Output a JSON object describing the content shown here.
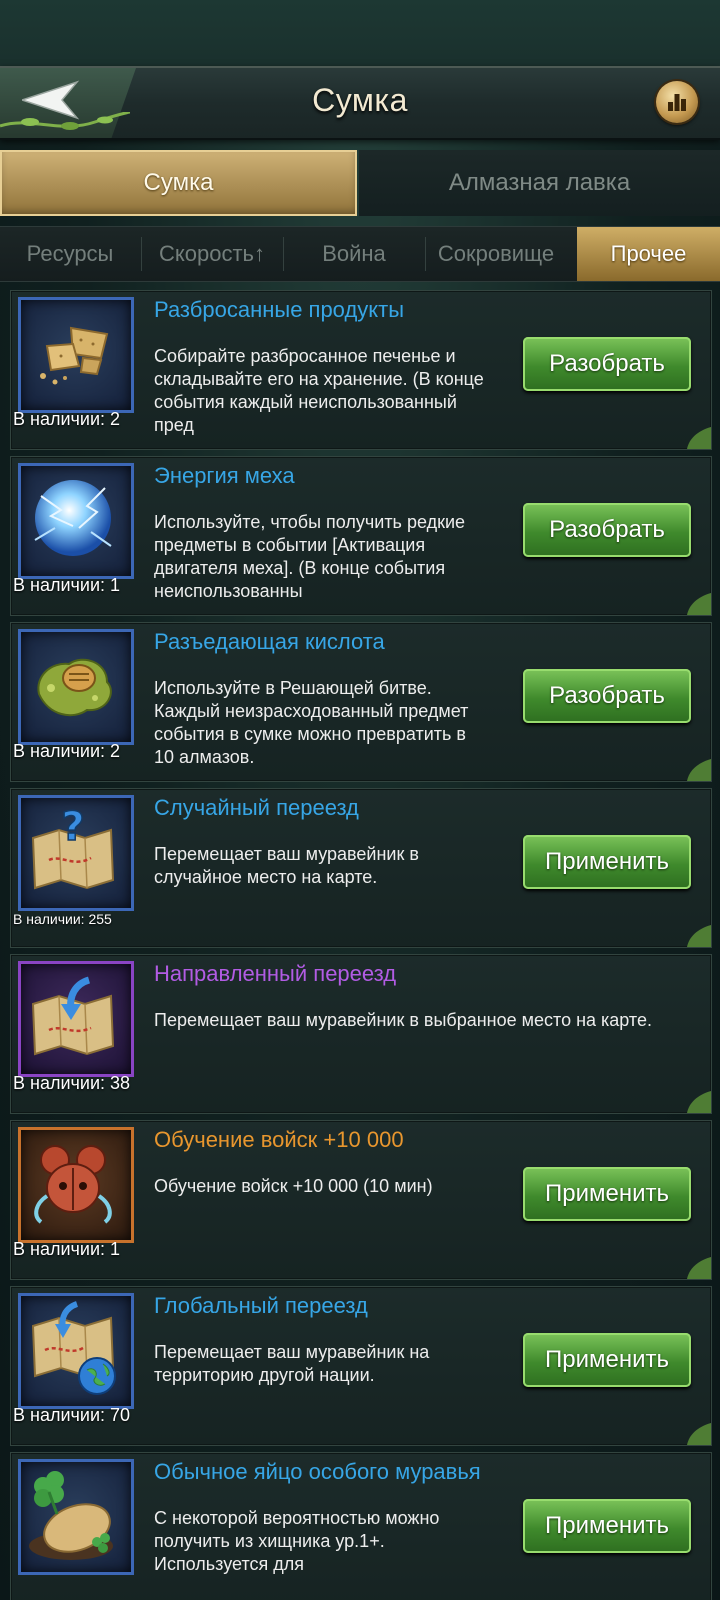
{
  "header": {
    "title": "Сумка"
  },
  "main_tabs": [
    {
      "label": "Сумка",
      "active": true
    },
    {
      "label": "Алмазная лавка",
      "active": false
    }
  ],
  "sub_tabs": [
    {
      "label": "Ресурсы",
      "active": false
    },
    {
      "label": "Скорость↑",
      "active": false
    },
    {
      "label": "Война",
      "active": false
    },
    {
      "label": "Сокровище",
      "active": false
    },
    {
      "label": "Прочее",
      "active": true
    }
  ],
  "items": [
    {
      "title": "Разбросанные продукты",
      "description": "Собирайте разбросанное печенье и складывайте его на хранение. (В конце события каждый неиспользованный пред",
      "quantity": "В наличии: 2",
      "button": "Разобрать",
      "rarity_color": "#37a6e6",
      "icon": "biscuit-crumbs-icon"
    },
    {
      "title": "Энергия меха",
      "description": "Используйте, чтобы получить редкие предметы в событии [Активация двигателя меха]. (В конце события неиспользованны",
      "quantity": "В наличии: 1",
      "button": "Разобрать",
      "rarity_color": "#37a6e6",
      "icon": "energy-orb-icon"
    },
    {
      "title": "Разъедающая кислота",
      "description": "Используйте в Решающей битве. Каждый неизрасходованный предмет события в сумке можно превратить в 10 алмазов.",
      "quantity": "В наличии: 2",
      "button": "Разобрать",
      "rarity_color": "#37a6e6",
      "icon": "acid-blob-icon"
    },
    {
      "title": "Случайный переезд",
      "description": "Перемещает ваш муравейник в случайное место на карте.",
      "quantity": "В наличии: 255",
      "button": "Применить",
      "rarity_color": "#37a6e6",
      "icon": "random-map-icon"
    },
    {
      "title": "Направленный переезд",
      "description": "Перемещает ваш муравейник в выбранное место на карте.",
      "quantity": "В наличии: 38",
      "button": "",
      "rarity_color": "#b25ce4",
      "icon": "targeted-map-icon"
    },
    {
      "title": "Обучение войск +10 000",
      "description": "Обучение войск +10 000 (10 мин)",
      "quantity": "В наличии: 1",
      "button": "Применить",
      "rarity_color": "#e8962e",
      "icon": "ant-head-icon"
    },
    {
      "title": "Глобальный переезд",
      "description": "Перемещает ваш муравейник на территорию другой нации.",
      "quantity": "В наличии: 70",
      "button": "Применить",
      "rarity_color": "#37a6e6",
      "icon": "globe-map-icon"
    },
    {
      "title": "Обычное яйцо особого муравья",
      "description": "С некоторой вероятностью можно получить из хищника ур.1+. Используется для",
      "quantity": "",
      "button": "Применить",
      "rarity_color": "#37a6e6",
      "icon": "clover-egg-icon"
    }
  ]
}
